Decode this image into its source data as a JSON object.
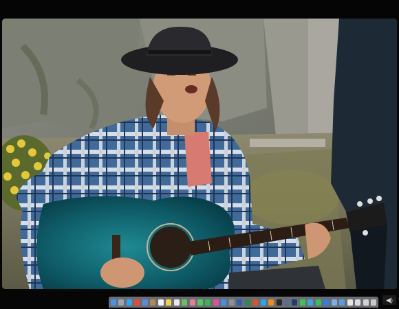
{
  "dock": {
    "icons": [
      {
        "name": "finder-icon",
        "color": "#4d8fe0"
      },
      {
        "name": "launchpad-icon",
        "color": "#9aa4b5"
      },
      {
        "name": "safari-icon",
        "color": "#3aa0e8"
      },
      {
        "name": "chrome-icon",
        "color": "#e04a3a"
      },
      {
        "name": "mail-icon",
        "color": "#5b8dd6"
      },
      {
        "name": "contacts-icon",
        "color": "#b08955"
      },
      {
        "name": "calendar-icon",
        "color": "#f2f2f2"
      },
      {
        "name": "notes-icon",
        "color": "#f3d04a"
      },
      {
        "name": "reminders-icon",
        "color": "#e8e8e8"
      },
      {
        "name": "maps-icon",
        "color": "#6bbf5a"
      },
      {
        "name": "photos-icon",
        "color": "#e97a9c"
      },
      {
        "name": "messages-icon",
        "color": "#53c85c"
      },
      {
        "name": "facetime-icon",
        "color": "#3cb34c"
      },
      {
        "name": "itunes-icon",
        "color": "#e04e9b"
      },
      {
        "name": "app-store-icon",
        "color": "#3f8fe8"
      },
      {
        "name": "preferences-icon",
        "color": "#8a8f98"
      },
      {
        "name": "word-icon",
        "color": "#2f5fb3"
      },
      {
        "name": "excel-icon",
        "color": "#2e8a4a"
      },
      {
        "name": "powerpoint-icon",
        "color": "#d2552c"
      },
      {
        "name": "skype-icon",
        "color": "#2ca6e8"
      },
      {
        "name": "vlc-icon",
        "color": "#f08a1a"
      },
      {
        "name": "terminal-icon",
        "color": "#2a2a2a"
      },
      {
        "name": "quicktime-icon",
        "color": "#5a6d8a"
      },
      {
        "name": "photoshop-icon",
        "color": "#1c3f6e"
      },
      {
        "name": "whatsapp-icon",
        "color": "#3ec456"
      },
      {
        "name": "telegram-icon",
        "color": "#3aa4dd"
      },
      {
        "name": "spotify-icon",
        "color": "#35c05a"
      },
      {
        "name": "dropbox-icon",
        "color": "#2d7fe0"
      },
      {
        "name": "folder-icon",
        "color": "#79aee8"
      },
      {
        "name": "downloads-icon",
        "color": "#5a9be0"
      },
      {
        "name": "document-icon",
        "color": "#e6e6e6"
      },
      {
        "name": "document-icon-2",
        "color": "#dcdcdc"
      },
      {
        "name": "document-icon-3",
        "color": "#d2d2d2"
      },
      {
        "name": "trash-icon",
        "color": "#c8c8c8"
      }
    ]
  },
  "tray": {
    "icon": "speaker-icon",
    "glyph": "◀)"
  }
}
